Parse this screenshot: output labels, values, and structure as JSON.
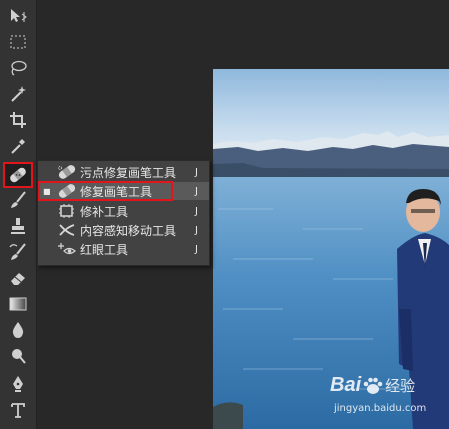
{
  "toolbar": {
    "tools": [
      {
        "name": "move-tool",
        "icon": "move-icon"
      },
      {
        "name": "marquee-tool",
        "icon": "marquee-icon"
      },
      {
        "name": "lasso-tool",
        "icon": "lasso-icon"
      },
      {
        "name": "magic-wand-tool",
        "icon": "magic-wand-icon"
      },
      {
        "name": "crop-tool",
        "icon": "crop-icon"
      },
      {
        "name": "eyedropper-tool",
        "icon": "eyedropper-icon"
      },
      {
        "name": "healing-brush-tool",
        "icon": "bandage-icon",
        "active": true
      },
      {
        "name": "brush-tool",
        "icon": "brush-icon"
      },
      {
        "name": "clone-stamp-tool",
        "icon": "stamp-icon"
      },
      {
        "name": "history-brush-tool",
        "icon": "history-brush-icon"
      },
      {
        "name": "eraser-tool",
        "icon": "eraser-icon"
      },
      {
        "name": "gradient-tool",
        "icon": "gradient-icon"
      },
      {
        "name": "blur-tool",
        "icon": "drop-icon"
      },
      {
        "name": "dodge-tool",
        "icon": "dodge-icon"
      },
      {
        "name": "pen-tool",
        "icon": "pen-icon"
      },
      {
        "name": "type-tool",
        "icon": "type-icon"
      }
    ]
  },
  "flyout": {
    "items": [
      {
        "label": "污点修复画笔工具",
        "shortcut": "J",
        "icon": "spot-healing-icon",
        "selected": false
      },
      {
        "label": "修复画笔工具",
        "shortcut": "J",
        "icon": "healing-brush-icon",
        "selected": true
      },
      {
        "label": "修补工具",
        "shortcut": "J",
        "icon": "patch-icon",
        "selected": false
      },
      {
        "label": "内容感知移动工具",
        "shortcut": "J",
        "icon": "content-aware-move-icon",
        "selected": false
      },
      {
        "label": "红眼工具",
        "shortcut": "J",
        "icon": "red-eye-icon",
        "selected": false
      }
    ],
    "selected_marker": "■"
  },
  "watermark": {
    "brand": "Bai",
    "brand2": "经验",
    "url": "jingyan.baidu.com"
  },
  "colors": {
    "highlight_red": "#e0161c",
    "panel_bg": "#333333",
    "workspace_bg": "#282828"
  }
}
